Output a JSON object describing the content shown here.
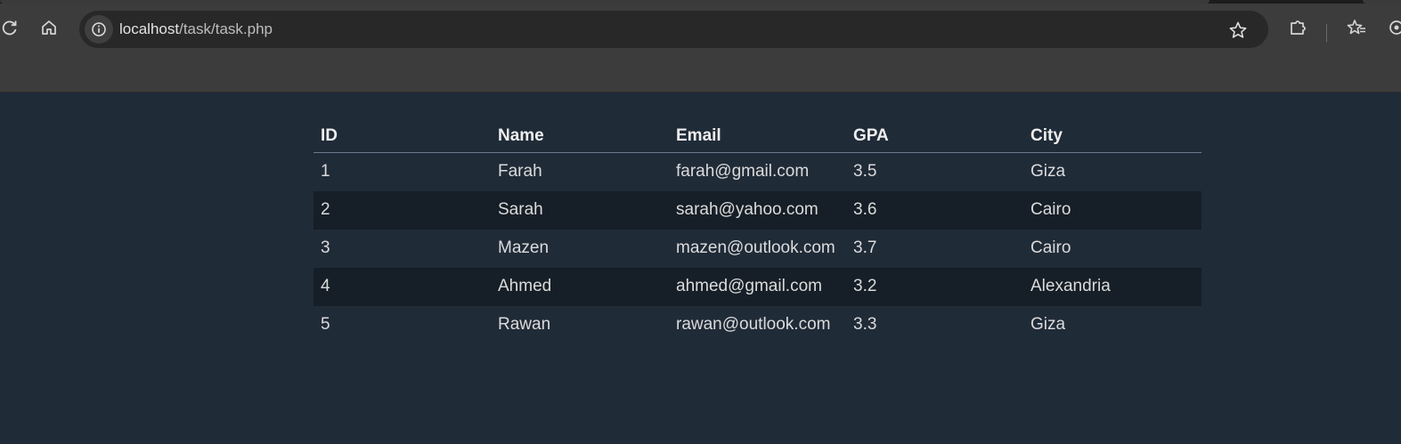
{
  "browser": {
    "url_host": "localhost",
    "url_path": "/task/task.php"
  },
  "table": {
    "headers": [
      "ID",
      "Name",
      "Email",
      "GPA",
      "City"
    ],
    "rows": [
      [
        "1",
        "Farah",
        "farah@gmail.com",
        "3.5",
        "Giza"
      ],
      [
        "2",
        "Sarah",
        "sarah@yahoo.com",
        "3.6",
        "Cairo"
      ],
      [
        "3",
        "Mazen",
        "mazen@outlook.com",
        "3.7",
        "Cairo"
      ],
      [
        "4",
        "Ahmed",
        "ahmed@gmail.com",
        "3.2",
        "Alexandria"
      ],
      [
        "5",
        "Rawan",
        "rawan@outlook.com",
        "3.3",
        "Giza"
      ]
    ]
  },
  "colors": {
    "page_bg": "#202b38",
    "row_alt_bg": "#161f27",
    "toolbar_bg": "#3c3c3c",
    "omnibox_bg": "#282828"
  }
}
